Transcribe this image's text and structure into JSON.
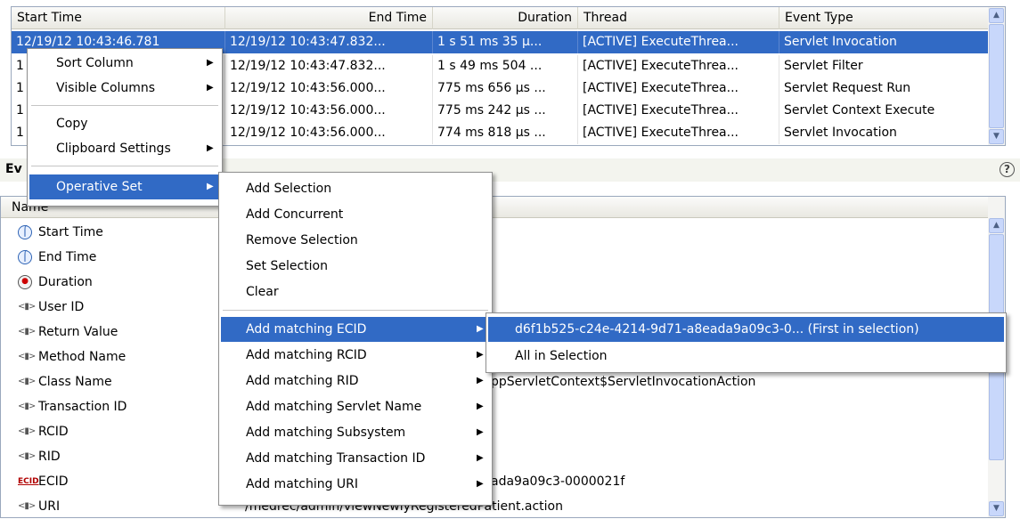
{
  "events_table": {
    "columns": [
      "Start Time",
      "End Time",
      "Duration",
      "Thread",
      "Event Type"
    ],
    "rows": [
      {
        "start": "12/19/12 10:43:46.781",
        "end": "12/19/12 10:43:47.832...",
        "duration": "1 s 51 ms 35 μ...",
        "thread": "[ACTIVE] ExecuteThrea...",
        "type": "Servlet Invocation",
        "selected": true
      },
      {
        "start": "1",
        "end": "12/19/12 10:43:47.832...",
        "duration": "1 s 49 ms 504 ...",
        "thread": "[ACTIVE] ExecuteThrea...",
        "type": "Servlet Filter"
      },
      {
        "start": "1",
        "end": "12/19/12 10:43:56.000...",
        "duration": "775 ms 656 μs ...",
        "thread": "[ACTIVE] ExecuteThrea...",
        "type": "Servlet Request Run"
      },
      {
        "start": "1",
        "end": "12/19/12 10:43:56.000...",
        "duration": "775 ms 242 μs ...",
        "thread": "[ACTIVE] ExecuteThrea...",
        "type": "Servlet Context Execute"
      },
      {
        "start": "1",
        "end": "12/19/12 10:43:56.000...",
        "duration": "774 ms 818 μs ...",
        "thread": "[ACTIVE] ExecuteThrea...",
        "type": "Servlet Invocation"
      }
    ]
  },
  "details": {
    "title": "Ev",
    "column_name": "Name",
    "help_icon": "question-circle-icon",
    "properties": [
      {
        "icon": "clock-icon",
        "name": "Start Time",
        "value": ""
      },
      {
        "icon": "clock-icon",
        "name": "End Time",
        "value": ""
      },
      {
        "icon": "stopwatch-icon",
        "name": "Duration",
        "value": ""
      },
      {
        "icon": "field-icon",
        "name": "User ID",
        "value": ""
      },
      {
        "icon": "field-icon",
        "name": "Return Value",
        "value": ""
      },
      {
        "icon": "field-icon",
        "name": "Method Name",
        "value": ""
      },
      {
        "icon": "field-icon",
        "name": "Class Name",
        "value": "ppServletContext$ServletInvocationAction"
      },
      {
        "icon": "field-icon",
        "name": "Transaction ID",
        "value": ""
      },
      {
        "icon": "field-icon",
        "name": "RCID",
        "value": ""
      },
      {
        "icon": "field-icon",
        "name": "RID",
        "value": ""
      },
      {
        "icon": "ecid-icon",
        "name": "ECID",
        "value": "ada9a09c3-0000021f"
      },
      {
        "icon": "field-icon",
        "name": "URI",
        "value": "/medrec/admin/viewNewlyRegisteredPatient.action"
      }
    ]
  },
  "context_menu": {
    "items": [
      "Sort Column",
      "Visible Columns",
      "Copy",
      "Clipboard Settings",
      "Operative Set"
    ],
    "highlighted": "Operative Set"
  },
  "operative_set_menu": {
    "items": [
      "Add Selection",
      "Add Concurrent",
      "Remove Selection",
      "Set Selection",
      "Clear",
      "Add matching ECID",
      "Add matching RCID",
      "Add matching RID",
      "Add matching Servlet Name",
      "Add matching Subsystem",
      "Add matching Transaction ID",
      "Add matching URI"
    ],
    "highlighted": "Add matching ECID"
  },
  "ecid_menu": {
    "items": [
      "d6f1b525-c24e-4214-9d71-a8eada9a09c3-0... (First in selection)",
      "All in Selection"
    ],
    "highlighted": "d6f1b525-c24e-4214-9d71-a8eada9a09c3-0... (First in selection)"
  },
  "colors": {
    "selection": "#316ac5",
    "header": "#ece9d8",
    "border": "#9aa8bd"
  }
}
